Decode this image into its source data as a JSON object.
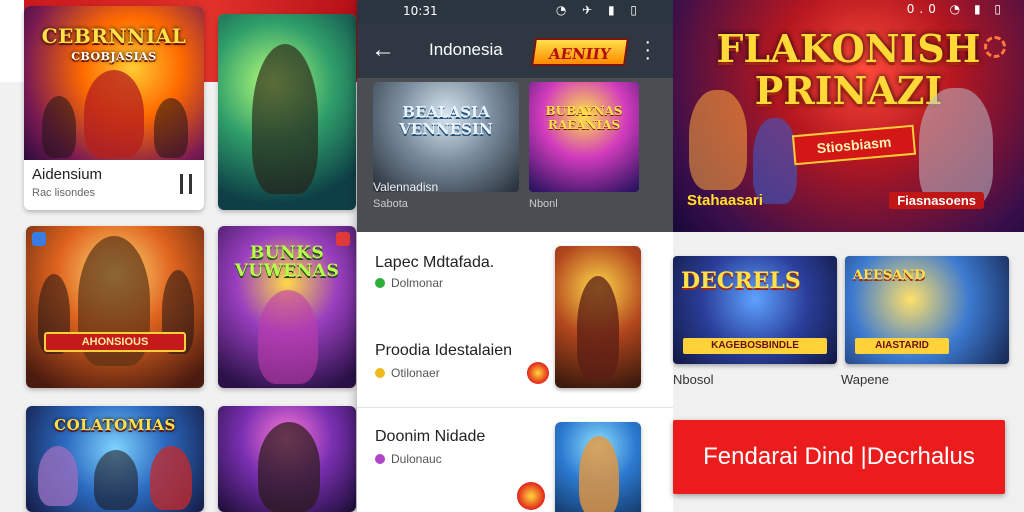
{
  "left_panel": {
    "top_card": {
      "art_title": "CEBRNNIAL",
      "art_subtitle": "CBOBJASIAS",
      "title": "Aidensium",
      "subtitle": "Rac lisondes"
    },
    "cards": [
      {
        "ribbon": "AHONSIOUS"
      },
      {
        "art_title": "BUNKS VUWENAS"
      },
      {
        "art_title": "COLATOMIAS"
      },
      {
        "art_title": ""
      }
    ]
  },
  "phone": {
    "status_time": "10:31",
    "status_icons": "◔ ✈ ▮ ▯",
    "toolbar": {
      "title": "Indonesia",
      "logo_text": "AENIIY"
    },
    "featured": [
      {
        "art_title": "BEALASIA VENNESIN",
        "label": "Valennadisn",
        "sublabel": "Sabota"
      },
      {
        "art_title": "BUBAYNAS RAEANIAS",
        "label": "",
        "sublabel": "Nbonl"
      }
    ],
    "list": [
      {
        "name": "Lapec Mdtafada.",
        "meta": "Dolmonar",
        "dot_color": "#2fae3a"
      },
      {
        "name": "Proodia Idestalaien",
        "meta": "Otilonaer",
        "dot_color": "#f0b91e"
      },
      {
        "name": "Doonim Nidade",
        "meta": "Dulonauc",
        "dot_color": "#b046c9"
      }
    ]
  },
  "right_panel": {
    "status_icons": "0.0 ◔ ▮ ▯",
    "hero": {
      "headline_1": "FLAKONISH",
      "headline_2": "PRINAZI",
      "ribbon": "Stiosbiasm",
      "tag_left": "Stahaasari",
      "tag_right": "Fiasnasoens"
    },
    "tiles": [
      {
        "title": "DECRELS",
        "strip": "KAGEBOSBINDLE",
        "label": "Nbosol"
      },
      {
        "title": "AEESAND",
        "strip": "AIASTARID",
        "label": "Wapene"
      }
    ],
    "cta": "Fendarai Dind |Decrhalus"
  }
}
